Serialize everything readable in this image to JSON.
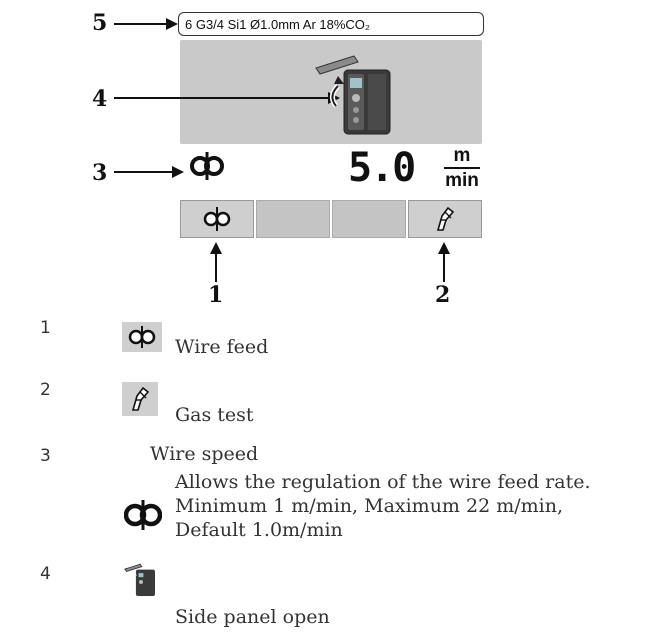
{
  "diagram": {
    "callouts": {
      "c1": "1",
      "c2": "2",
      "c3": "3",
      "c4": "4",
      "c5": "5"
    },
    "status_line": "6 G3/4 Si1  Ø1.0mm  Ar 18%CO₂",
    "wire_speed_value": "5.0",
    "wire_speed_unit_top": "m",
    "wire_speed_unit_bottom": "min",
    "buttons": [
      "wire-feed",
      "empty",
      "empty",
      "gas-test"
    ]
  },
  "legend": [
    {
      "number": "1",
      "icon": "wire-feed-icon",
      "label": "Wire feed"
    },
    {
      "number": "2",
      "icon": "gas-test-icon",
      "label": "Gas test"
    },
    {
      "number": "3",
      "icon": "wire-speed-icon",
      "label": "Wire speed",
      "description": [
        "Allows the regulation of the wire feed rate.",
        "Minimum 1 m/min, Maximum 22 m/min,",
        "Default 1.0m/min"
      ]
    },
    {
      "number": "4",
      "icon": "side-panel-open-icon",
      "label": "Side panel open"
    }
  ],
  "colors": {
    "panel_gray": "#c9c9c9",
    "button_gray": "#cfcfcf",
    "text": "#222222"
  }
}
